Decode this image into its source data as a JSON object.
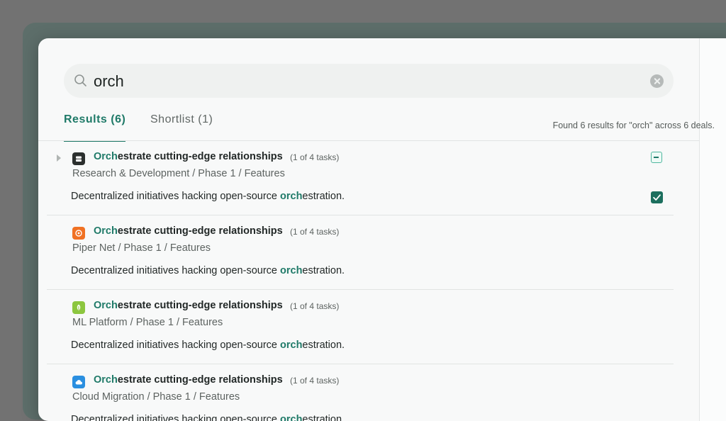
{
  "search": {
    "query": "orch",
    "placeholder": ""
  },
  "tabs": [
    {
      "label": "Results (6)",
      "active": true
    },
    {
      "label": "Shortlist (1)",
      "active": false
    }
  ],
  "found_text": "Found 6 results for \"orch\" across 6 deals.",
  "results": [
    {
      "title_match": "Orch",
      "title_rest": "estrate cutting-edge relationships",
      "tasks": "(1 of 4 tasks)",
      "path": "Research & Development / Phase 1 / Features",
      "desc_before": "Decentralized initiatives hacking open-source ",
      "desc_match": "orch",
      "desc_after": "estration.",
      "icon": "robot-icon",
      "icon_color": "#2b2f2e",
      "expandable": true,
      "shortlist_partial": true,
      "checked": true
    },
    {
      "title_match": "Orch",
      "title_rest": "estrate cutting-edge relationships",
      "tasks": "(1 of 4 tasks)",
      "path": "Piper Net / Phase 1 / Features",
      "desc_before": "Decentralized initiatives hacking open-source ",
      "desc_match": "orch",
      "desc_after": "estration.",
      "icon": "piper-icon",
      "icon_color": "#f07123"
    },
    {
      "title_match": "Orch",
      "title_rest": "estrate cutting-edge relationships",
      "tasks": "(1 of 4 tasks)",
      "path": "ML Platform / Phase 1 / Features",
      "desc_before": "Decentralized initiatives hacking open-source ",
      "desc_match": "orch",
      "desc_after": "estration.",
      "icon": "leaf-icon",
      "icon_color": "#8cc63f"
    },
    {
      "title_match": "Orch",
      "title_rest": "estrate cutting-edge relationships",
      "tasks": "(1 of 4 tasks)",
      "path": "Cloud Migration / Phase 1 / Features",
      "desc_before": "Decentralized initiatives hacking open-source ",
      "desc_match": "orch",
      "desc_after": "estration.",
      "icon": "cloud-icon",
      "icon_color": "#2a8fe0"
    }
  ],
  "colors": {
    "accent": "#1f7a68",
    "backdrop": "#5d6e6a"
  }
}
